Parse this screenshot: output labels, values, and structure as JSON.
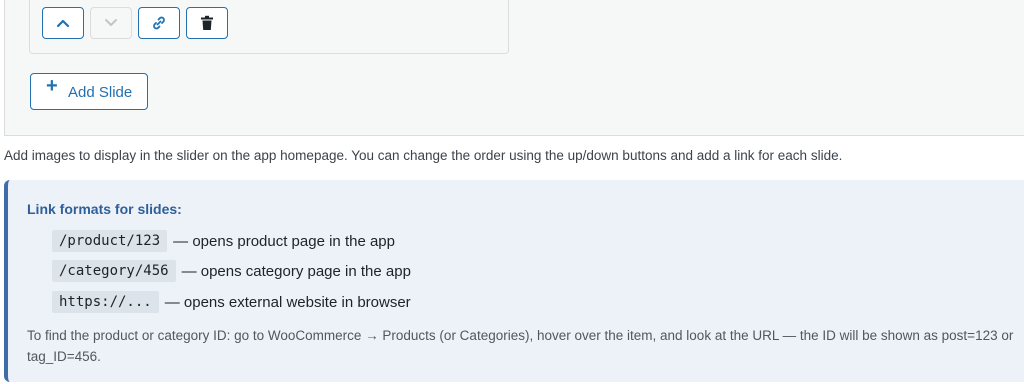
{
  "slide_controls": {
    "move_up": "up",
    "move_down": "down",
    "link": "link",
    "delete": "delete"
  },
  "add_slide": {
    "icon": "+",
    "label": "Add Slide"
  },
  "help_text": "Add images to display in the slider on the app homepage. You can change the order using the up/down buttons and add a link for each slide.",
  "info": {
    "title": "Link formats for slides:",
    "formats": [
      {
        "code": "/product/123",
        "desc": "— opens product page in the app"
      },
      {
        "code": "/category/456",
        "desc": "— opens category page in the app"
      },
      {
        "code": "https://...",
        "desc": "— opens external website in browser"
      }
    ],
    "note": "To find the product or category ID: go to WooCommerce → Products (or Categories), hover over the item, and look at the URL — the ID will be shown as post=123 or tag_ID=456."
  },
  "colors": {
    "accent": "#2271b1",
    "info_border": "#3e6da8",
    "info_bg": "#edf2f8"
  }
}
